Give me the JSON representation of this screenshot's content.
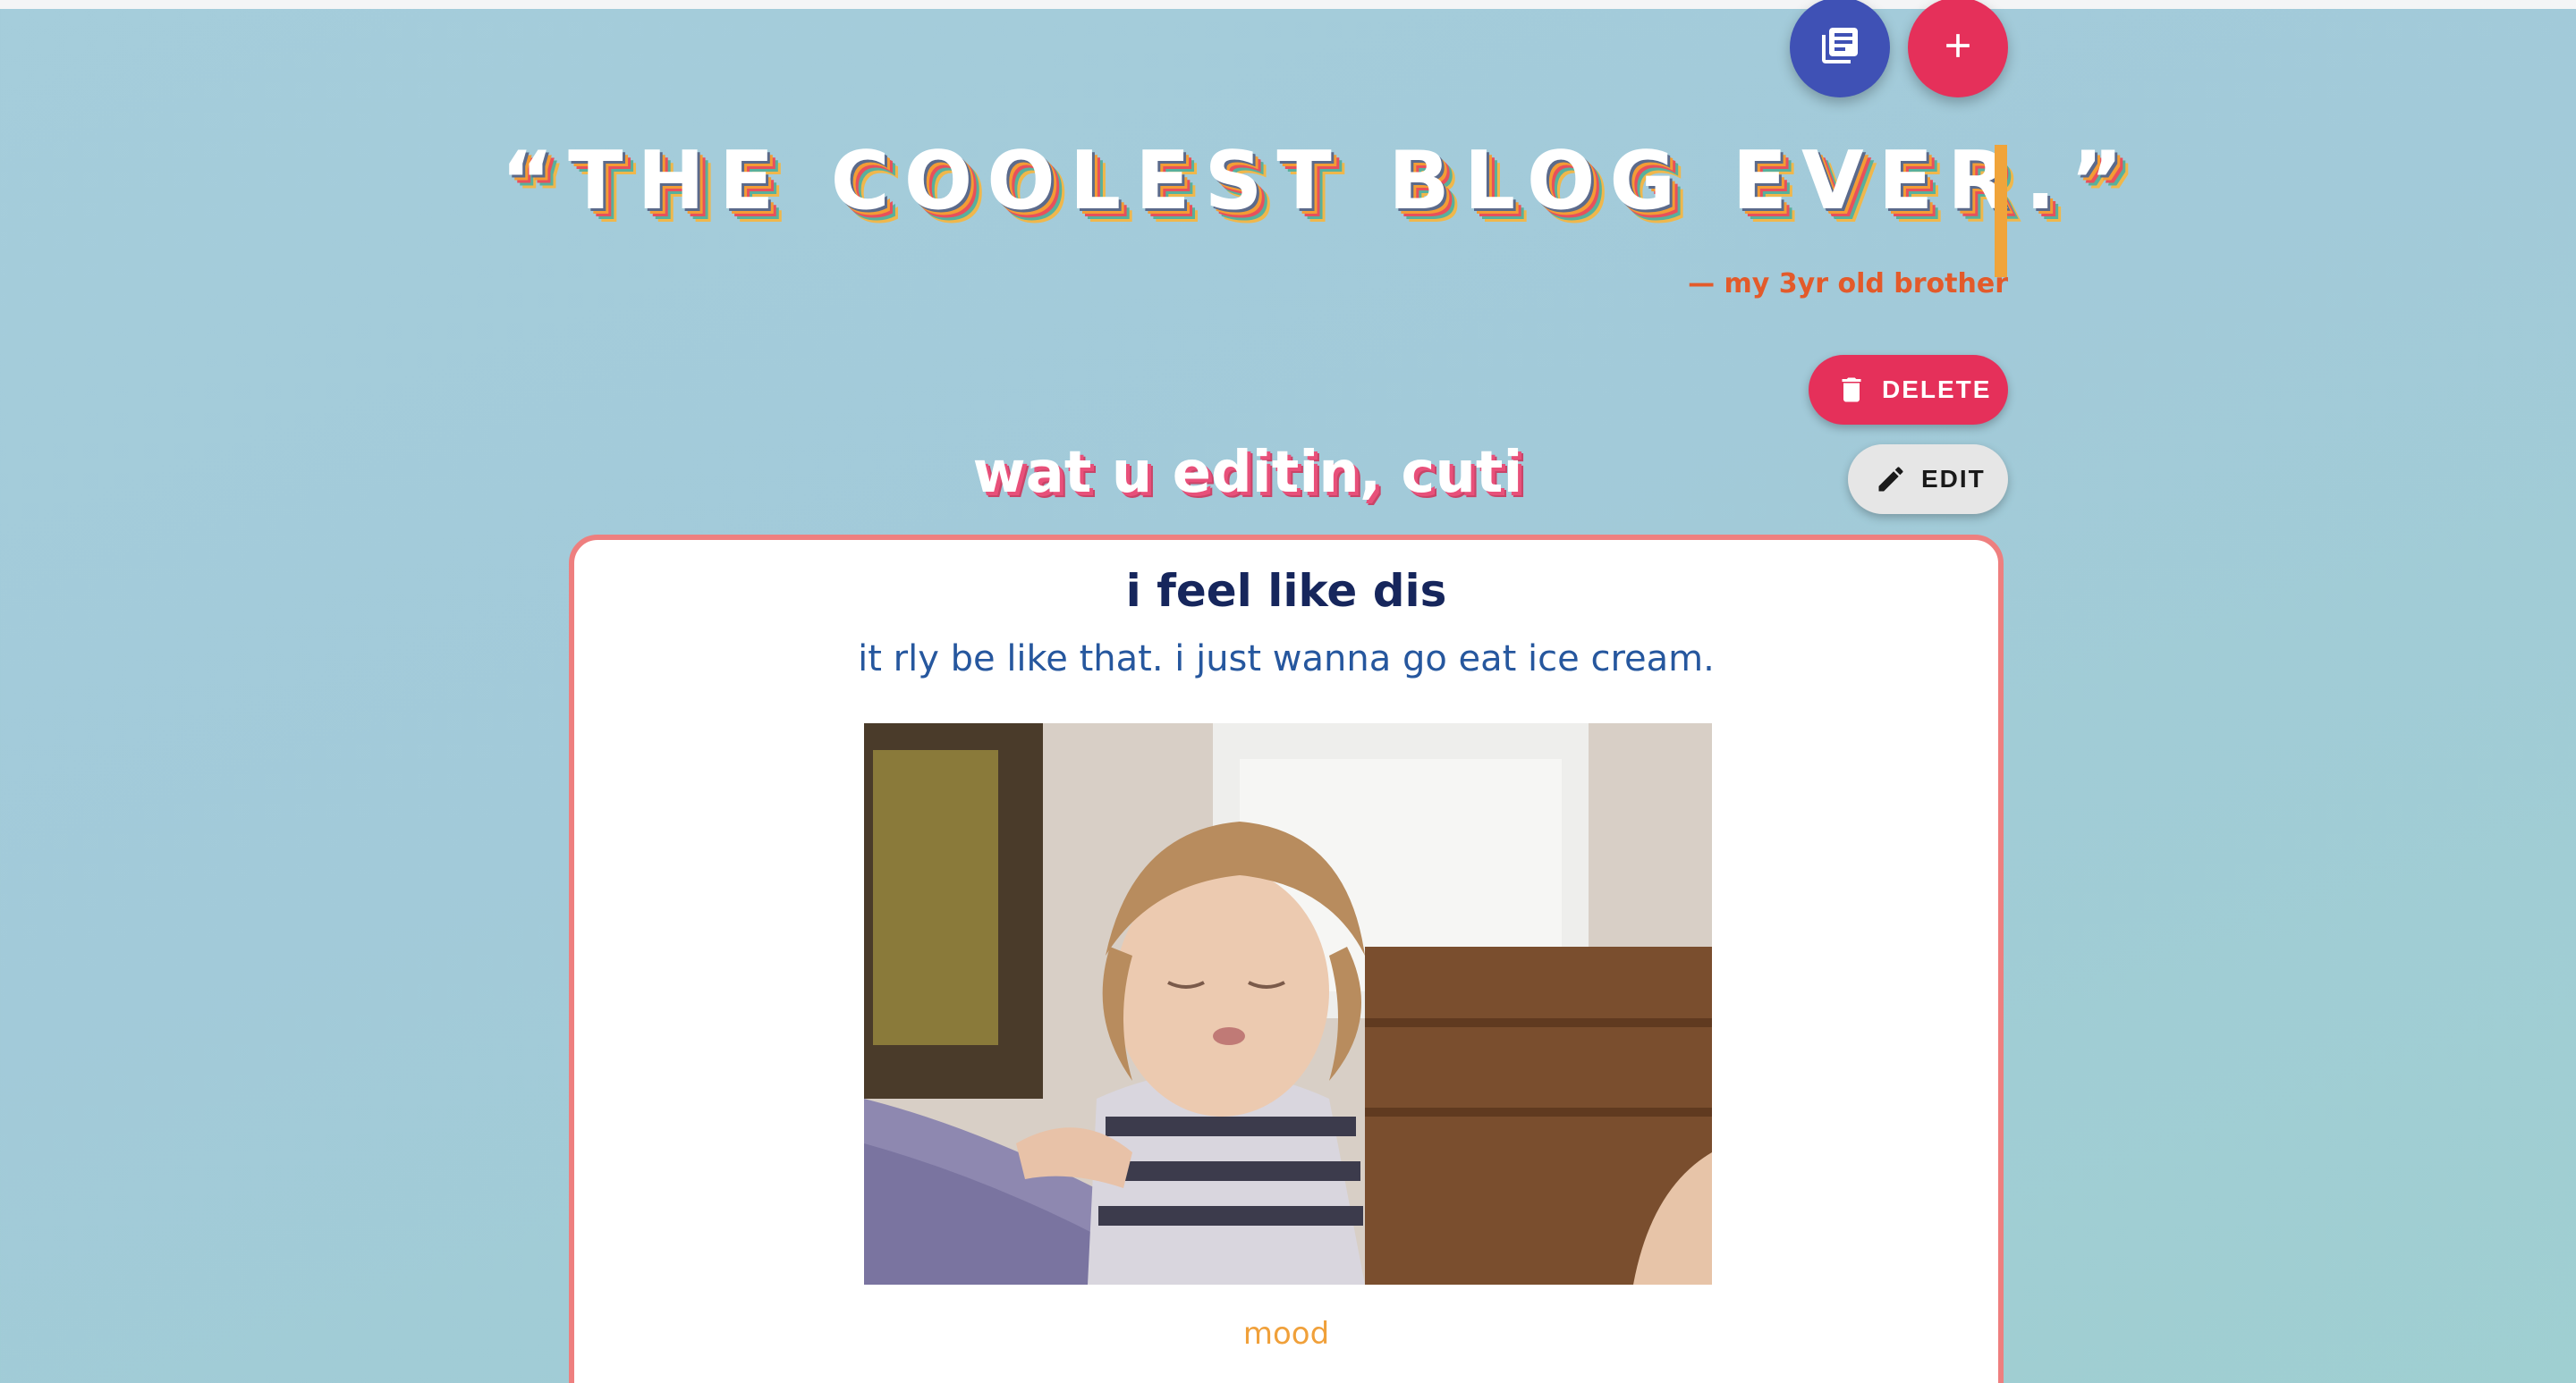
{
  "header": {
    "posts_button_icon": "library-books-icon",
    "add_button_icon": "plus-icon",
    "quote": "“THE COOLEST BLOG EVER.”",
    "attribution": "— my 3yr old brother"
  },
  "actions": {
    "delete_label": "DELETE",
    "delete_icon": "trash-icon",
    "edit_label": "EDIT",
    "edit_icon": "pencil-icon"
  },
  "editor": {
    "heading": "wat u editin, cuti"
  },
  "post": {
    "title": "i feel like dis",
    "subtitle": "it rly be like that. i just wanna go eat ice cream.",
    "caption": "mood"
  },
  "colors": {
    "accent_pink": "#e5305a",
    "accent_indigo": "#3f51b5",
    "card_border": "#ee7f7f",
    "title_navy": "#16265c",
    "subtitle_blue": "#26579e",
    "caption_orange": "#f0a03a",
    "attribution_orange": "#e35a2a"
  }
}
